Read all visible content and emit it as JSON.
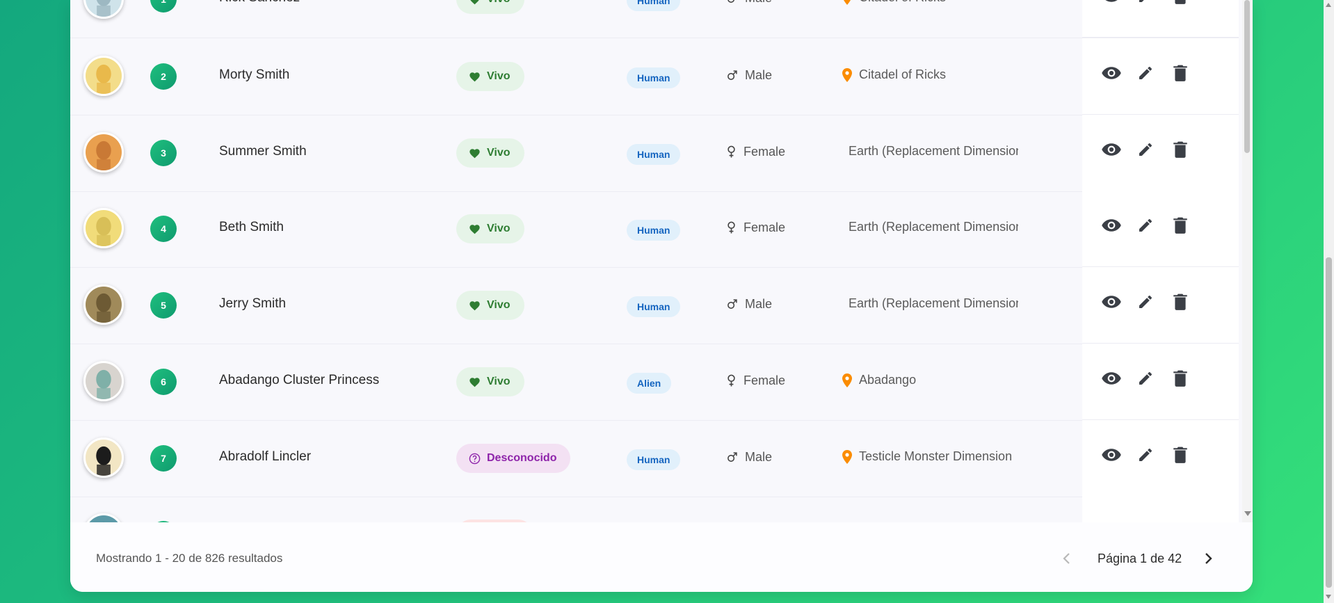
{
  "colors": {
    "accent": "#1fbf7e",
    "alive_bg": "#e6f4e8",
    "alive_fg": "#2e7d32",
    "unknown_bg": "#f3e1f3",
    "unknown_fg": "#8e24aa",
    "species_bg": "#e1f0fb",
    "species_fg": "#1565c0",
    "location_pin": "#fb8c00",
    "action_icon": "#3b3f46"
  },
  "rows": [
    {
      "id": "1",
      "name": "Rick Sanchez",
      "status": "Vivo",
      "species": "Human",
      "gender": "Male",
      "location": "Citadel of Ricks",
      "has_pin": true
    },
    {
      "id": "2",
      "name": "Morty Smith",
      "status": "Vivo",
      "species": "Human",
      "gender": "Male",
      "location": "Citadel of Ricks",
      "has_pin": true
    },
    {
      "id": "3",
      "name": "Summer Smith",
      "status": "Vivo",
      "species": "Human",
      "gender": "Female",
      "location": "Earth (Replacement Dimension)",
      "has_pin": false
    },
    {
      "id": "4",
      "name": "Beth Smith",
      "status": "Vivo",
      "species": "Human",
      "gender": "Female",
      "location": "Earth (Replacement Dimension)",
      "has_pin": false
    },
    {
      "id": "5",
      "name": "Jerry Smith",
      "status": "Vivo",
      "species": "Human",
      "gender": "Male",
      "location": "Earth (Replacement Dimension)",
      "has_pin": false
    },
    {
      "id": "6",
      "name": "Abadango Cluster Princess",
      "status": "Vivo",
      "species": "Alien",
      "gender": "Female",
      "location": "Abadango",
      "has_pin": true
    },
    {
      "id": "7",
      "name": "Abradolf Lincler",
      "status": "Desconocido",
      "species": "Human",
      "gender": "Male",
      "location": "Testicle Monster Dimension",
      "has_pin": true
    },
    {
      "id": "8",
      "name": "",
      "status": "",
      "species": "",
      "gender": "",
      "location": "",
      "has_pin": false
    }
  ],
  "footer": {
    "results_text": "Mostrando 1 - 20 de 826 resultados",
    "page_text": "Página 1 de 42"
  },
  "icons": [
    "eye-icon",
    "pencil-icon",
    "trash-icon",
    "heart-icon",
    "help-circle-icon",
    "male-icon",
    "female-icon",
    "location-pin-icon",
    "chevron-left-icon",
    "chevron-right-icon"
  ]
}
